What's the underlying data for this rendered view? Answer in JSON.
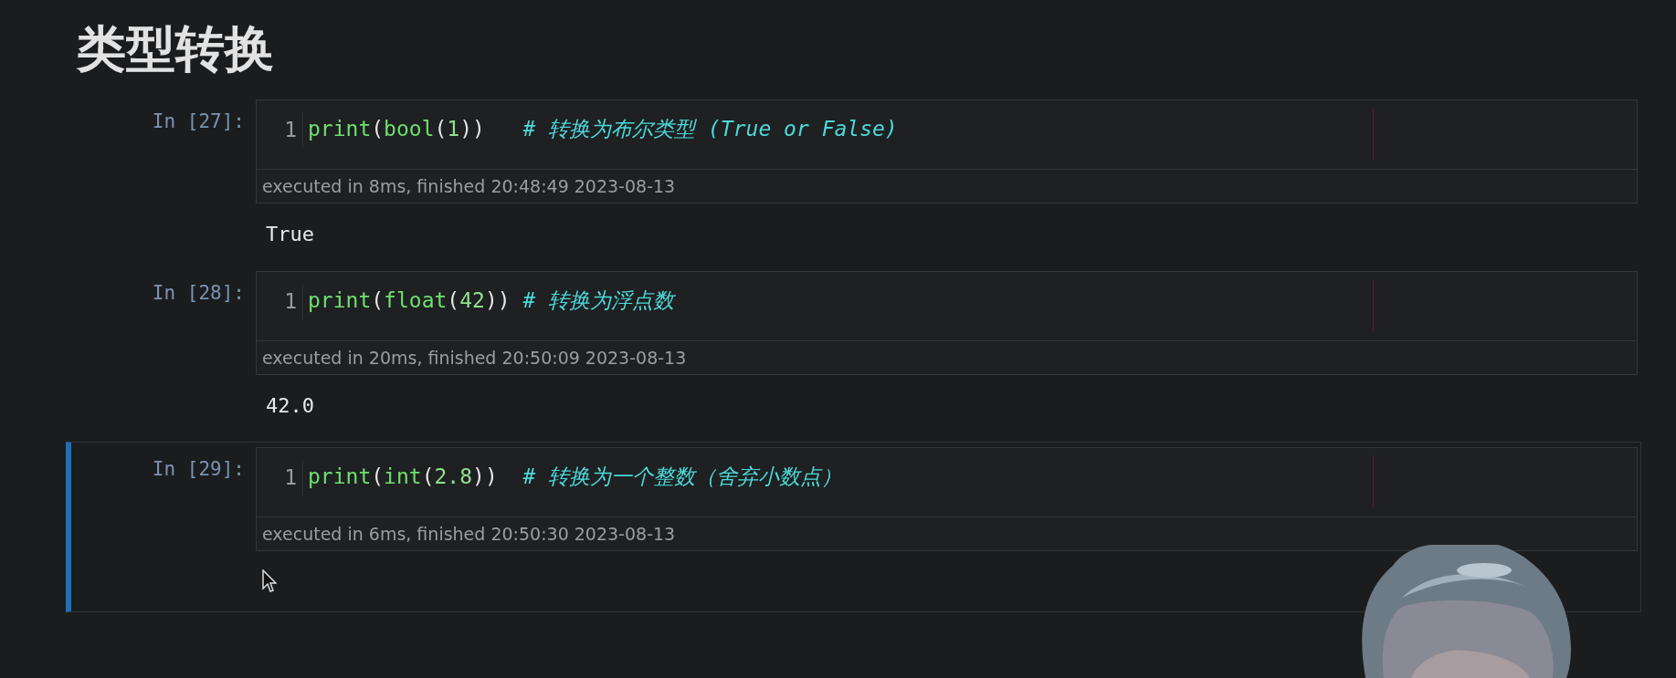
{
  "title": "类型转换",
  "cells": [
    {
      "prompt": "In [27]:",
      "line_number": "1",
      "selected": false,
      "code": [
        {
          "kind": "builtin",
          "text": "print"
        },
        {
          "kind": "punct",
          "text": "("
        },
        {
          "kind": "builtin",
          "text": "bool"
        },
        {
          "kind": "punct",
          "text": "("
        },
        {
          "kind": "number",
          "text": "1"
        },
        {
          "kind": "punct",
          "text": "))   "
        },
        {
          "kind": "comment",
          "text": "# 转换为布尔类型 (True or False)"
        }
      ],
      "exec_info": "executed in 8ms, finished 20:48:49 2023-08-13",
      "output": "True"
    },
    {
      "prompt": "In [28]:",
      "line_number": "1",
      "selected": false,
      "code": [
        {
          "kind": "builtin",
          "text": "print"
        },
        {
          "kind": "punct",
          "text": "("
        },
        {
          "kind": "builtin",
          "text": "float"
        },
        {
          "kind": "punct",
          "text": "("
        },
        {
          "kind": "number",
          "text": "42"
        },
        {
          "kind": "punct",
          "text": ")) "
        },
        {
          "kind": "comment",
          "text": "# 转换为浮点数"
        }
      ],
      "exec_info": "executed in 20ms, finished 20:50:09 2023-08-13",
      "output": "42.0"
    },
    {
      "prompt": "In [29]:",
      "line_number": "1",
      "selected": true,
      "code": [
        {
          "kind": "builtin",
          "text": "print"
        },
        {
          "kind": "punct",
          "text": "("
        },
        {
          "kind": "builtin",
          "text": "int"
        },
        {
          "kind": "punct",
          "text": "("
        },
        {
          "kind": "number",
          "text": "2.8"
        },
        {
          "kind": "punct",
          "text": "))  "
        },
        {
          "kind": "comment",
          "text": "# 转换为一个整数（舍弃小数点）"
        }
      ],
      "exec_info": "executed in 6ms, finished 20:50:30 2023-08-13"
    }
  ]
}
